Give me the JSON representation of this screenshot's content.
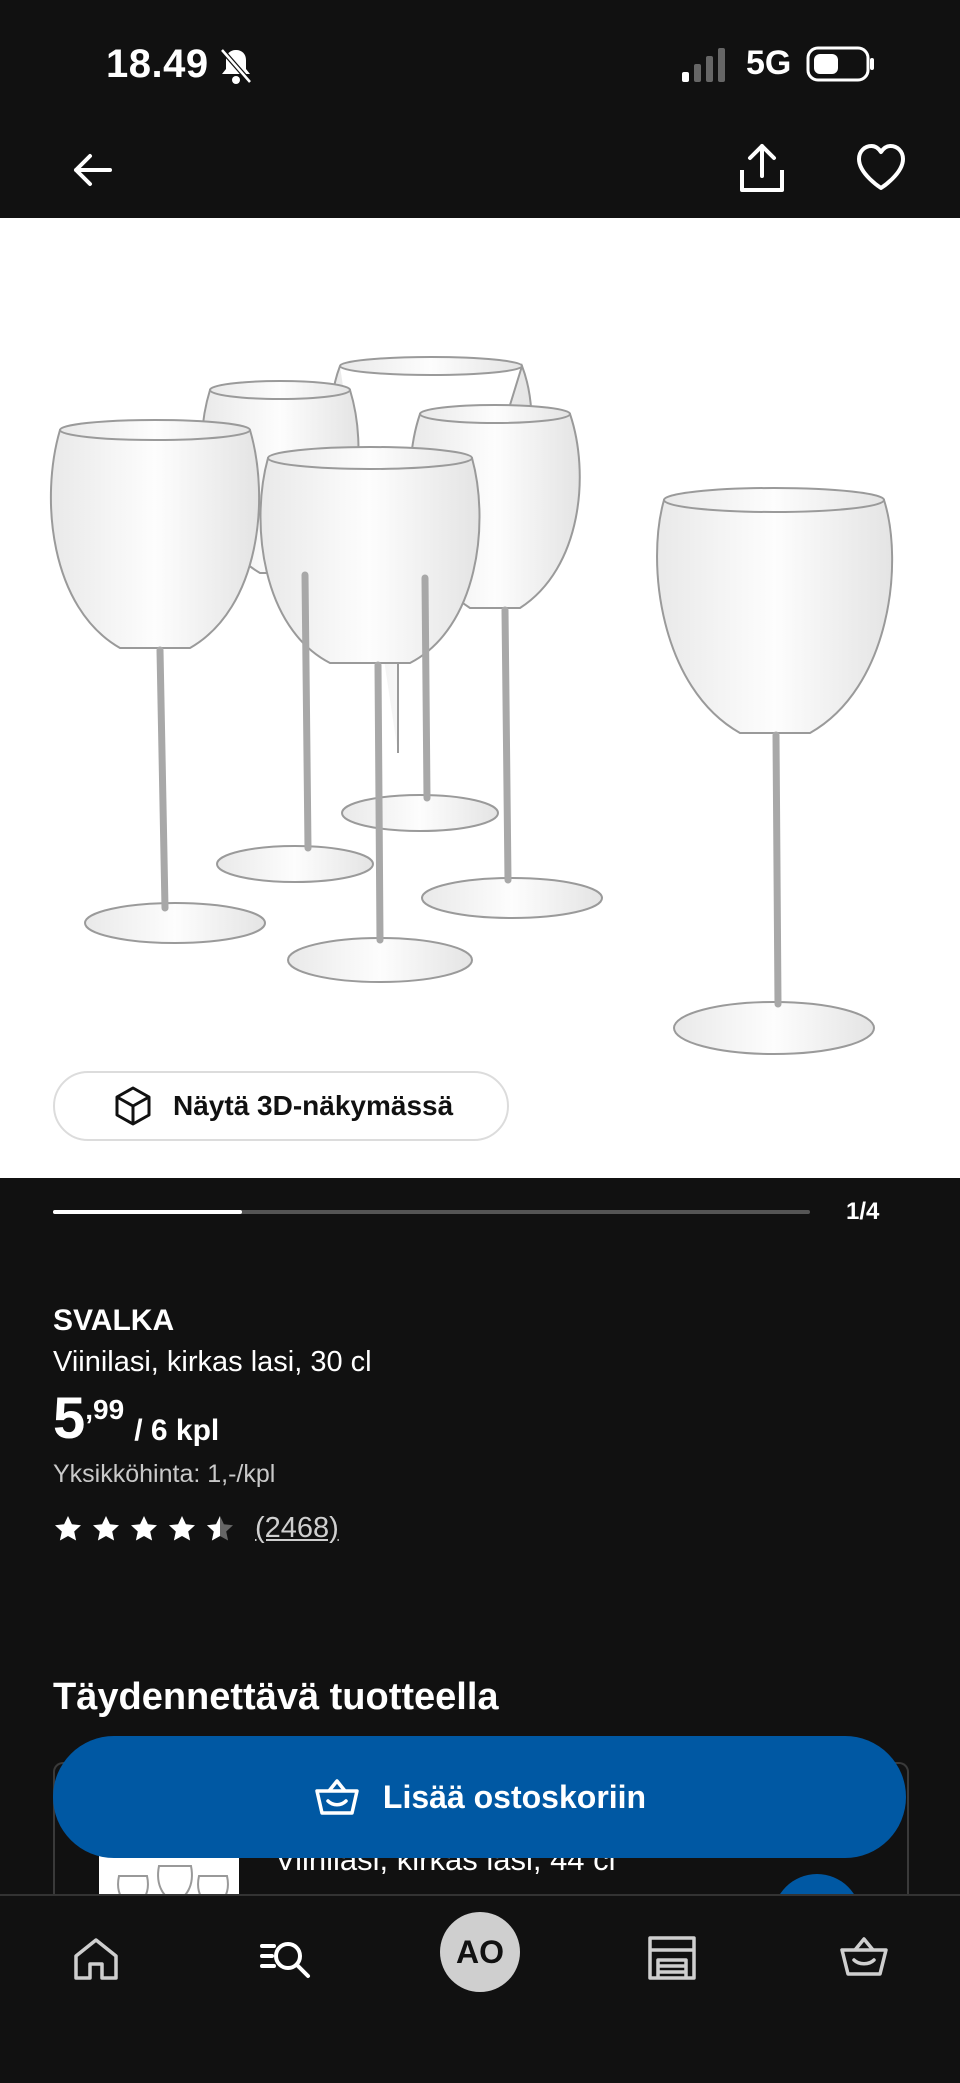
{
  "status_bar": {
    "time": "18.49",
    "network": "5G"
  },
  "hero": {
    "button_3d_label": "Näytä 3D-näkymässä"
  },
  "gallery": {
    "counter": "1/4",
    "current": 1,
    "total": 4
  },
  "product": {
    "brand": "SVALKA",
    "description": "Viinilasi, kirkas lasi, 30 cl",
    "price_int": "5",
    "price_dec": ",99",
    "price_unit": "/ 6 kpl",
    "unit_price": "Yksikköhinta: 1,-/kpl",
    "rating_count": "(2468)",
    "rating": 4.5
  },
  "complement": {
    "title": "Täydennettävä tuotteella",
    "item_title": "Viinilasi, kirkas lasi, 44 cl"
  },
  "cta": {
    "add_to_cart": "Lisää ostoskoriin"
  },
  "bottom_nav": {
    "items": [
      "home-icon",
      "search-icon",
      "avatar",
      "store-icon",
      "cart-icon"
    ],
    "avatar_initials": "AO"
  },
  "colors": {
    "accent": "#0058a3",
    "background": "#111111"
  }
}
